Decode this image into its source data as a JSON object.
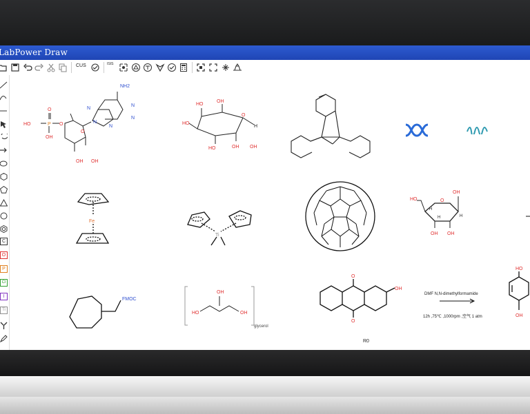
{
  "app": {
    "title": "LabPower Draw"
  },
  "toolbar": {
    "items": [
      {
        "icon": "open-icon"
      },
      {
        "icon": "save-icon"
      },
      {
        "icon": "undo-icon"
      },
      {
        "icon": "redo-icon"
      },
      {
        "icon": "cut-icon"
      },
      {
        "icon": "copy-icon"
      },
      {
        "label": "CUS"
      },
      {
        "icon": "clean-icon"
      },
      {
        "label": "ISIS"
      },
      {
        "icon": "recognize-icon"
      },
      {
        "icon": "atom-icon"
      },
      {
        "icon": "ring-icon"
      },
      {
        "icon": "chiral-icon"
      },
      {
        "icon": "check-icon"
      },
      {
        "icon": "calculator-icon"
      },
      {
        "icon": "fit-icon"
      },
      {
        "icon": "zoom-icon"
      },
      {
        "icon": "expand-icon"
      },
      {
        "icon": "template-icon"
      }
    ]
  },
  "sidebar": {
    "items": [
      {
        "icon": "line-icon"
      },
      {
        "icon": "curve-icon"
      },
      {
        "icon": "bond-icon"
      },
      {
        "icon": "select-icon"
      },
      {
        "icon": "lasso-icon"
      },
      {
        "icon": "arrow-icon"
      },
      {
        "icon": "ellipse-icon"
      },
      {
        "icon": "hexagon-icon"
      },
      {
        "icon": "pentagon-icon"
      },
      {
        "icon": "triangle-icon"
      },
      {
        "icon": "circle-icon"
      },
      {
        "icon": "benzene-icon"
      },
      {
        "label": "C"
      },
      {
        "label": "O"
      },
      {
        "label": "P"
      },
      {
        "label": "Cl"
      },
      {
        "label": "I"
      },
      {
        "label": "Ti"
      },
      {
        "icon": "tool-icon"
      },
      {
        "icon": "pen-icon"
      }
    ]
  },
  "canvas": {
    "labels": {
      "nh2": "NH2",
      "ho1": "HO",
      "p": "P",
      "o_dbl": "O",
      "oh_p": "OH",
      "o_link": "O",
      "n1": "N",
      "n2": "N",
      "n3": "N",
      "n4": "N",
      "n5": "N",
      "o_ring1": "O",
      "oh_a": "OH",
      "oh_b": "OH",
      "ho_g1": "HO",
      "oh_g1": "OH",
      "ho_g2": "HO",
      "ho_g3": "HO",
      "oh_g2": "OH",
      "oh_g3": "OH",
      "o_g": "O",
      "h_g1": "H",
      "fe": "Fe",
      "ti": "Ti",
      "ho_r": "HO",
      "oh_r1": "OH",
      "o_r": "O",
      "oh_r2": "OH",
      "oh_r3": "OH",
      "h_r1": "H",
      "h_r2": "H",
      "h_r3": "H",
      "fmoc": "FMOC",
      "ho_gly": "HO",
      "oh_gly1": "OH",
      "oh_gly2": "OH",
      "glycerol": "glycerol",
      "o_aq1": "O",
      "o_aq2": "O",
      "oh_aq": "OH",
      "r0": "R0",
      "reaction_top": "DMF N,N-dimethylformamide",
      "reaction_bottom": "12h ,75℃ ,1000rpm ,空气 1 atm",
      "ho_hq": "HO",
      "oh_hq": "OH"
    }
  }
}
